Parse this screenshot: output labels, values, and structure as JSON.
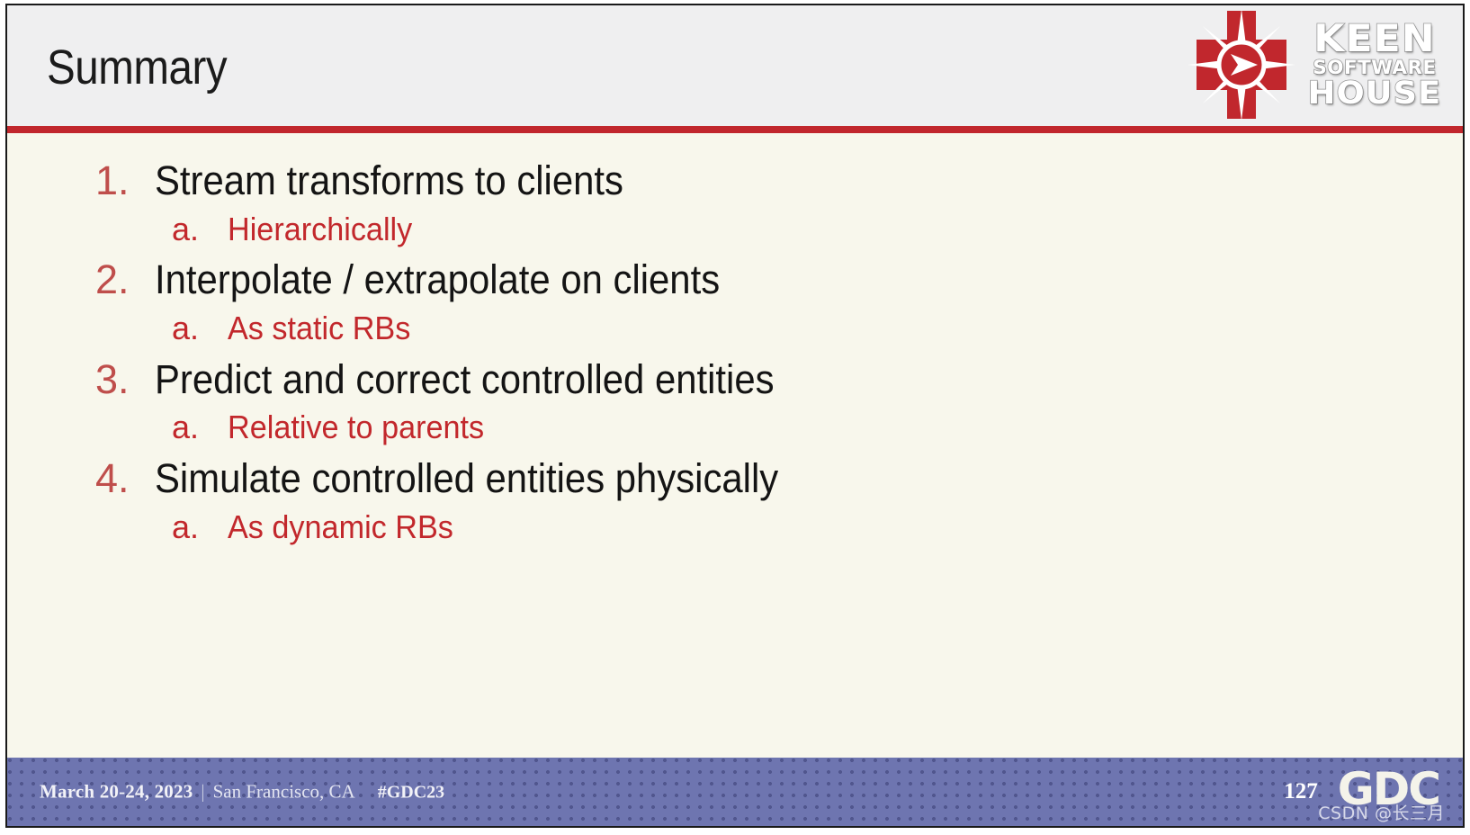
{
  "slide": {
    "title": "Summary",
    "page_number": "127"
  },
  "brand": {
    "mark_name": "keen-software-house-logo",
    "wordmark": {
      "line1": "KEEN",
      "line2": "SOFTWARE",
      "line3": "HOUSE"
    }
  },
  "content": {
    "items": [
      {
        "marker": "1.",
        "text": "Stream transforms to clients",
        "sub": {
          "marker": "a.",
          "text": "Hierarchically"
        }
      },
      {
        "marker": "2.",
        "text": "Interpolate / extrapolate on clients",
        "sub": {
          "marker": "a.",
          "text": "As static RBs"
        }
      },
      {
        "marker": "3.",
        "text": "Predict and correct controlled entities",
        "sub": {
          "marker": "a.",
          "text": "Relative to parents"
        }
      },
      {
        "marker": "4.",
        "text": "Simulate controlled entities physically",
        "sub": {
          "marker": "a.",
          "text": "As dynamic RBs"
        }
      }
    ]
  },
  "footer": {
    "date": "March 20-24, 2023",
    "separator": "|",
    "city": "San Francisco, CA",
    "hashtag": "#GDC23",
    "conference_logo": "GDC",
    "watermark": "CSDN @长三月"
  },
  "colors": {
    "header_bg": "#efeff0",
    "header_rule": "#c1272d",
    "slide_bg": "#f8f7ec",
    "marker_red": "#bf4e4b",
    "sub_red": "#c2282c",
    "body_text": "#141414",
    "footer_bg": "#6e75b0",
    "brand_red": "#c1272d"
  }
}
